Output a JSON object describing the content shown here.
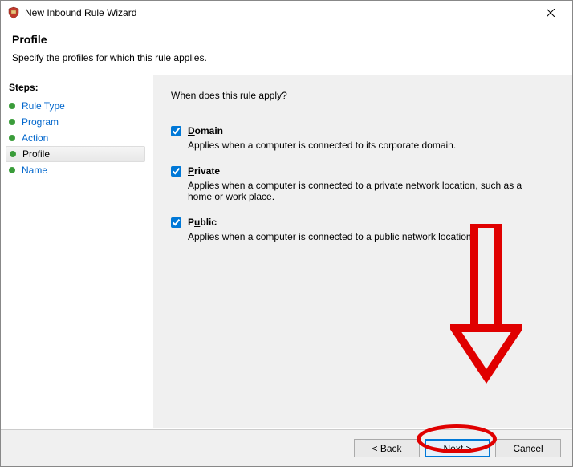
{
  "window": {
    "title": "New Inbound Rule Wizard"
  },
  "header": {
    "title": "Profile",
    "subtitle": "Specify the profiles for which this rule applies."
  },
  "sidebar": {
    "label": "Steps:",
    "items": [
      {
        "label": "Rule Type",
        "current": false
      },
      {
        "label": "Program",
        "current": false
      },
      {
        "label": "Action",
        "current": false
      },
      {
        "label": "Profile",
        "current": true
      },
      {
        "label": "Name",
        "current": false
      }
    ]
  },
  "content": {
    "question": "When does this rule apply?",
    "options": [
      {
        "key": "domain",
        "label_prefix": "D",
        "label_rest": "omain",
        "checked": true,
        "desc": "Applies when a computer is connected to its corporate domain."
      },
      {
        "key": "private",
        "label_prefix": "P",
        "label_rest": "rivate",
        "checked": true,
        "desc": "Applies when a computer is connected to a private network location, such as a home or work place."
      },
      {
        "key": "public",
        "label_prefix": "P",
        "label_rest": "ublic",
        "label_underline_second": true,
        "checked": true,
        "desc": "Applies when a computer is connected to a public network location."
      }
    ]
  },
  "footer": {
    "back_prefix": "< ",
    "back_u": "B",
    "back_rest": "ack",
    "next_u": "N",
    "next_rest": "ext >",
    "cancel": "Cancel"
  }
}
